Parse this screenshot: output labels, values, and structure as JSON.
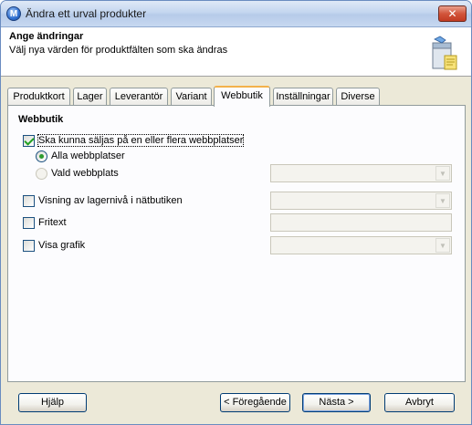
{
  "window": {
    "title": "Ändra ett urval produkter",
    "app_icon_letter": "M",
    "close_symbol": "✕"
  },
  "header": {
    "title": "Ange ändringar",
    "subtitle": "Välj nya värden för produktfälten som ska ändras",
    "icon": "products-box-icon"
  },
  "tabs": [
    {
      "label": "Produktkort"
    },
    {
      "label": "Lager"
    },
    {
      "label": "Leverantör"
    },
    {
      "label": "Variant"
    },
    {
      "label": "Webbutik"
    },
    {
      "label": "Inställningar"
    },
    {
      "label": "Diverse"
    }
  ],
  "active_tab": "Webbutik",
  "panel": {
    "section_title": "Webbutik",
    "sell_on_sites": {
      "label": "Ska kunna säljas på en eller flera webbplatser",
      "checked": true
    },
    "radio_all_sites": {
      "label": "Alla webbplatser",
      "selected": true
    },
    "radio_selected_site": {
      "label": "Vald webbplats",
      "selected": false,
      "combo_value": ""
    },
    "stock_level": {
      "label": "Visning av lagernivå i nätbutiken",
      "checked": false,
      "combo_value": ""
    },
    "free_text": {
      "label": "Fritext",
      "checked": false,
      "value": ""
    },
    "show_graphic": {
      "label": "Visa grafik",
      "checked": false,
      "combo_value": ""
    }
  },
  "buttons": {
    "help": "Hjälp",
    "previous": "< Föregående",
    "next": "Nästa >",
    "cancel": "Avbryt"
  },
  "colors": {
    "accent_tab": "#f3b24b",
    "window_bg": "#ece9d8",
    "button_border": "#003c74"
  }
}
